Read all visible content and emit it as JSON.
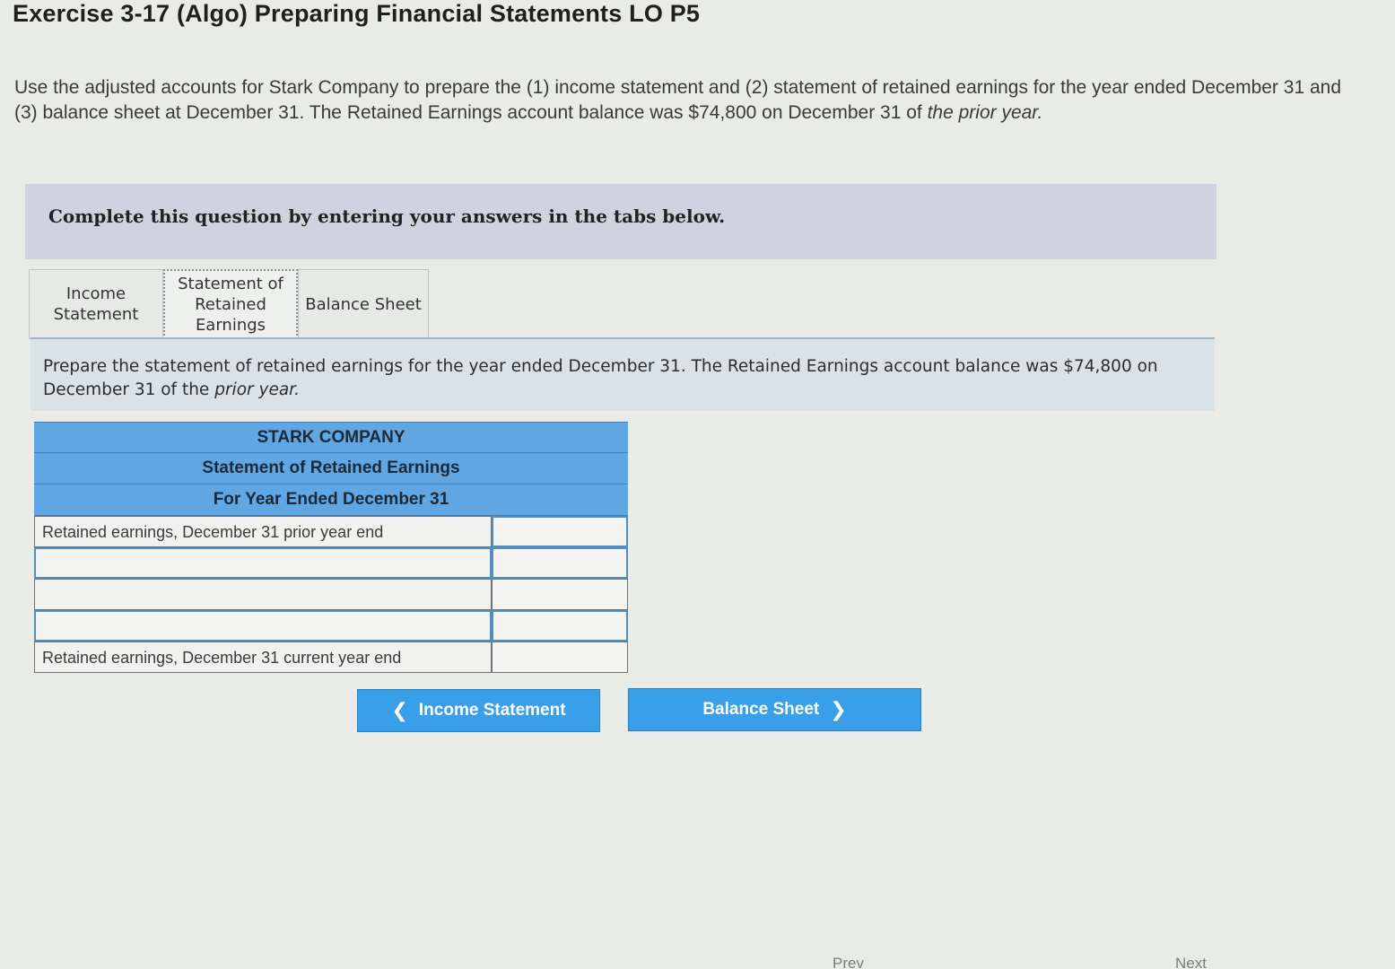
{
  "title": "Exercise 3-17 (Algo) Preparing Financial Statements LO P5",
  "intro": {
    "text": "Use the adjusted accounts for Stark Company to prepare the (1) income statement and (2) statement of retained earnings for the year ended December 31 and (3) balance sheet at December 31. The Retained Earnings account balance was $74,800 on December 31 of ",
    "emphasis": "the prior year."
  },
  "banner": "Complete this question by entering your answers in the tabs below.",
  "tabs": [
    {
      "label": "Income Statement",
      "active": false
    },
    {
      "label": "Statement of Retained Earnings",
      "active": true
    },
    {
      "label": "Balance Sheet",
      "active": false
    }
  ],
  "prompt": {
    "text": "Prepare the statement of retained earnings for the year ended December 31. The Retained Earnings account balance was $74,800 on December 31 of the ",
    "emphasis": "prior year."
  },
  "statement": {
    "company": "STARK COMPANY",
    "name": "Statement of Retained Earnings",
    "period": "For Year Ended December 31",
    "rows": [
      {
        "label": "Retained earnings, December 31 prior year end",
        "value": ""
      },
      {
        "label": "",
        "value": ""
      },
      {
        "label": "",
        "value": ""
      },
      {
        "label": "",
        "value": ""
      },
      {
        "label": "Retained earnings, December 31 current year end",
        "value": ""
      }
    ]
  },
  "buttons": {
    "prev": "Income Statement",
    "next": "Balance Sheet"
  },
  "icons": {
    "prev": "chevron-left-icon",
    "next": "chevron-right-icon"
  },
  "footer": {
    "prev": "Prev",
    "next": "Next"
  },
  "colors": {
    "header_blue": "#5fa6e2",
    "button_blue": "#3a9fe9",
    "banner": "#cfd3e0"
  }
}
